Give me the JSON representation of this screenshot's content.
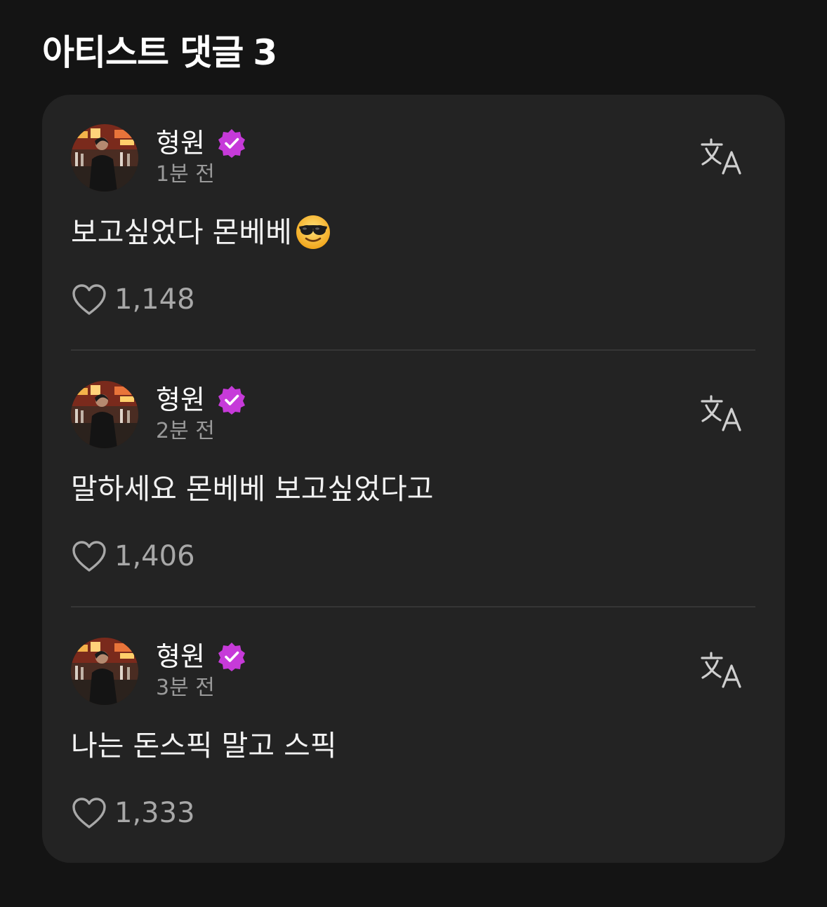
{
  "header": {
    "title": "아티스트 댓글",
    "count": "3"
  },
  "comments": [
    {
      "author": "형원",
      "verified": true,
      "time": "1분 전",
      "text": "보고싶었다 몬베베",
      "emoji": "smiling-face-with-sunglasses",
      "likes": "1,148"
    },
    {
      "author": "형원",
      "verified": true,
      "time": "2분 전",
      "text": "말하세요 몬베베 보고싶었다고",
      "likes": "1,406"
    },
    {
      "author": "형원",
      "verified": true,
      "time": "3분 전",
      "text": "나는 돈스픽 말고 스픽",
      "likes": "1,333"
    }
  ],
  "colors": {
    "background": "#141414",
    "card": "#232323",
    "verified_badge": "#c63ad9",
    "muted_text": "#9a9a9a"
  }
}
